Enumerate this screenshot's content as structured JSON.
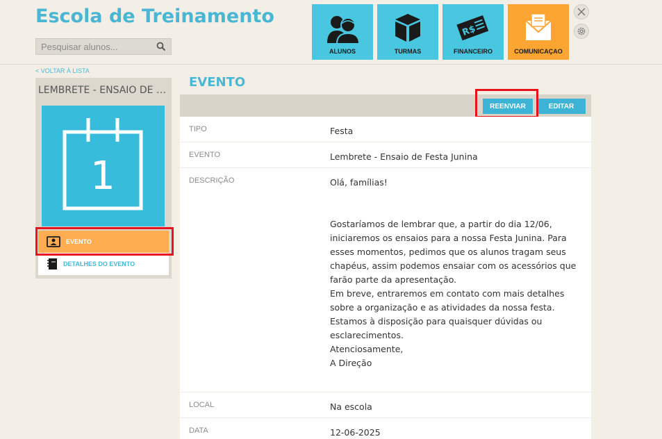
{
  "header": {
    "brand": "Escola de Treinamento",
    "search_placeholder": "Pesquisar alunos..."
  },
  "nav": {
    "items": [
      {
        "label": "ALUNOS",
        "icon": "students-icon"
      },
      {
        "label": "TURMAS",
        "icon": "box-icon"
      },
      {
        "label": "FINANCEIRO",
        "icon": "money-icon"
      },
      {
        "label": "COMUNICAÇAO",
        "icon": "envelope-icon",
        "active": true
      }
    ]
  },
  "sidebar": {
    "back_link": "< VOLTAR À LISTA",
    "card_title": "LEMBRETE - ENSAIO DE FESTA JUNINA",
    "calendar_day": "1",
    "menu": [
      {
        "label": "EVENTO",
        "active": true
      },
      {
        "label": "DETALHES DO EVENTO",
        "active": false
      }
    ]
  },
  "main": {
    "section_title": "EVENTO",
    "buttons": {
      "resend": "REENVIAR",
      "edit": "EDITAR"
    },
    "fields": [
      {
        "label": "TIPO",
        "value": "Festa"
      },
      {
        "label": "EVENTO",
        "value": "Lembrete - Ensaio de Festa Junina"
      },
      {
        "label": "DESCRIÇÃO",
        "lines": [
          "Olá, famílias!",
          "",
          "Gostaríamos de lembrar que, a partir do dia 12/06, iniciaremos os ensaios para a nossa Festa Junina. Para esses momentos, pedimos que os alunos tragam seus chapéus, assim podemos ensaiar com os acessórios que farão parte da apresentação.",
          "Em breve, entraremos em contato com mais detalhes sobre a organização e as atividades da nossa festa.",
          "Estamos à disposição para quaisquer dúvidas ou esclarecimentos.",
          "Atenciosamente,",
          "A Direção"
        ]
      },
      {
        "label": "LOCAL",
        "value": "Na escola"
      },
      {
        "label": "DATA",
        "value": "12-06-2025"
      }
    ]
  },
  "colors": {
    "accent": "#49b6d4",
    "active_orange": "#fda533",
    "highlight_red": "#e8121e",
    "background": "#f3efe6"
  }
}
